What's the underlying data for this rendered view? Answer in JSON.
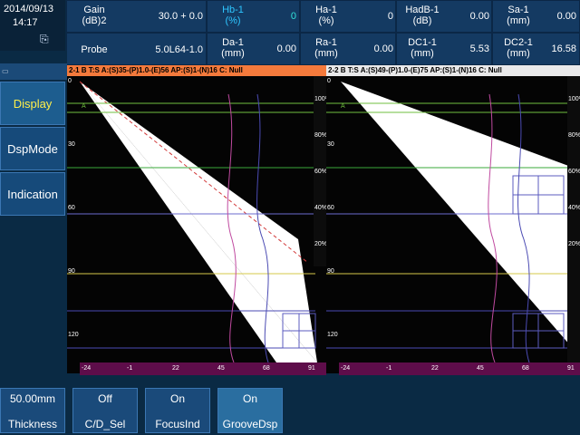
{
  "status": {
    "date": "2014/09/13",
    "time": "14:17"
  },
  "readings": {
    "gain": {
      "label": "Gain\n(dB)2",
      "value": "30.0 + 0.0"
    },
    "probe": {
      "label": "Probe",
      "value": "5.0L64-1.0"
    },
    "hb": {
      "label": "Hb-1\n(%)",
      "value": "0"
    },
    "ha": {
      "label": "Ha-1\n(%)",
      "value": "0"
    },
    "hadb": {
      "label": "HadB-1\n(dB)",
      "value": "0.00"
    },
    "sa": {
      "label": "Sa-1\n(mm)",
      "value": "0.00"
    },
    "da": {
      "label": "Da-1\n(mm)",
      "value": "0.00"
    },
    "ra": {
      "label": "Ra-1\n(mm)",
      "value": "0.00"
    },
    "dc1": {
      "label": "DC1-1\n(mm)",
      "value": "5.53"
    },
    "dc2": {
      "label": "DC2-1\n(mm)",
      "value": "16.58"
    }
  },
  "sidebar": {
    "display": "Display",
    "dspmode": "DspMode",
    "indication": "Indication"
  },
  "panels": {
    "left_header": "2-1 B  T:S A:(S)35-(P)1.0-(E)56 AP:(S)1-(N)16 C: Null",
    "right_header": "2-2 B  T:S A:(S)49-(P)1.0-(E)75 AP:(S)1-(N)16 C: Null",
    "ruler_left": [
      "-24",
      "-1",
      "22",
      "45",
      "68",
      "91"
    ],
    "ruler_right": [
      "-24",
      "-1",
      "22",
      "45",
      "68",
      "91"
    ],
    "depth_left": [
      "0",
      "30",
      "60",
      "90",
      "120"
    ],
    "depth_right": [
      "0",
      "30",
      "60",
      "90",
      "120"
    ],
    "colorbar": [
      "100%",
      "80%",
      "60%",
      "40%",
      "20%"
    ],
    "marker_a": "A"
  },
  "bottom": {
    "thickness": {
      "value": "50.00mm",
      "label": "Thickness"
    },
    "cdsel": {
      "value": "Off",
      "label": "C/D_Sel"
    },
    "focusind": {
      "value": "On",
      "label": "FocusInd"
    },
    "groovedsp": {
      "value": "On",
      "label": "GrooveDsp"
    }
  }
}
